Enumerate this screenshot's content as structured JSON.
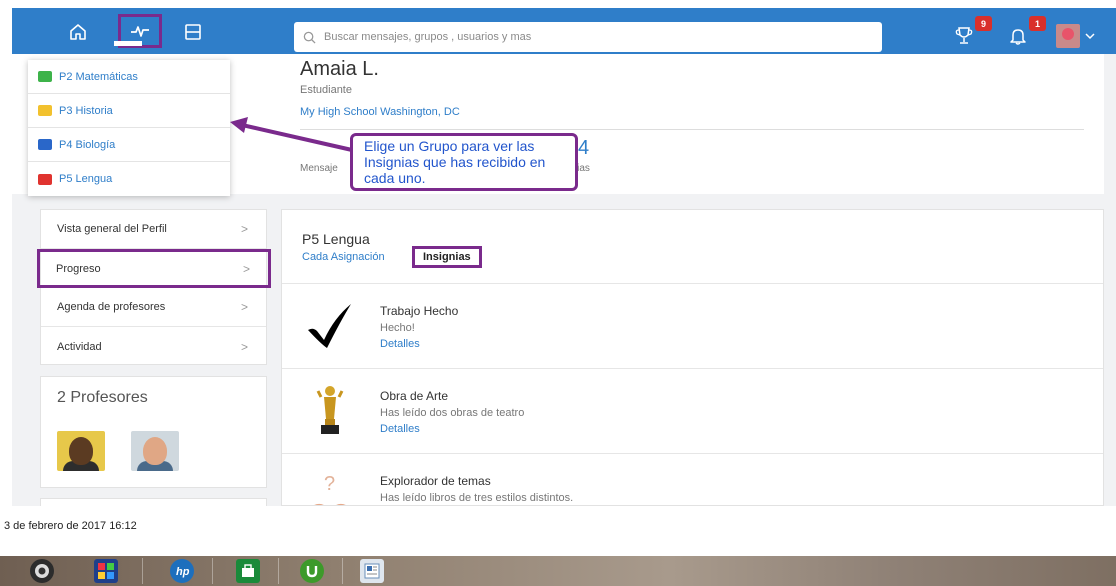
{
  "colors": {
    "brand": "#2f7ec9",
    "highlight": "#7a2a8c",
    "badge_red": "#d9302b"
  },
  "navbar": {
    "icons": [
      "home-icon",
      "progress-icon",
      "planner-icon"
    ],
    "search": {
      "placeholder": "Buscar mensajes, grupos , usuarios y mas"
    },
    "badges_count": "9",
    "notifications_count": "1"
  },
  "groups": [
    {
      "label": "P2 Matemáticas",
      "color": "#3db34a"
    },
    {
      "label": "P3 Historia",
      "color": "#f2c12e"
    },
    {
      "label": "P4 Biología",
      "color": "#2a67c9"
    },
    {
      "label": "P5 Lengua",
      "color": "#e0332f"
    }
  ],
  "profile": {
    "name": "Amaia L.",
    "role": "Estudiante",
    "school": "My High School Washington, DC",
    "stat_value": "4",
    "stat_label_left": "Mensaje",
    "stat_label_right": "gnias"
  },
  "callout": {
    "text": "Elige un Grupo para ver las Insignias que has recibido en cada uno."
  },
  "sidebar": {
    "items": [
      {
        "label": "Vista general del Perfil",
        "active": false
      },
      {
        "label": "Progreso",
        "active": true
      },
      {
        "label": "Agenda de profesores",
        "active": false
      },
      {
        "label": "Actividad",
        "active": false
      }
    ],
    "teachers_title": "2 Profesores"
  },
  "panel": {
    "title": "P5 Lengua",
    "tab_assign": "Cada Asignación",
    "tab_badges": "Insignias",
    "badges": [
      {
        "name": "Trabajo Hecho",
        "desc": "Hecho!",
        "link": "Detalles",
        "icon": "checkmark-icon"
      },
      {
        "name": "Obra de Arte",
        "desc": "Has leído dos obras de teatro",
        "link": "Detalles",
        "icon": "trophy-icon"
      },
      {
        "name": "Explorador de temas",
        "desc": "Has leído libros de tres estilos distintos.",
        "link": "",
        "icon": "book-icon"
      }
    ]
  },
  "footer": {
    "timestamp": "3 de febrero de 2017 16:12"
  },
  "taskbar": {
    "apps": [
      "camera-app-icon",
      "photos-app-icon",
      "hp-app-icon",
      "store-app-icon",
      "torrent-app-icon",
      "document-app-icon"
    ]
  }
}
